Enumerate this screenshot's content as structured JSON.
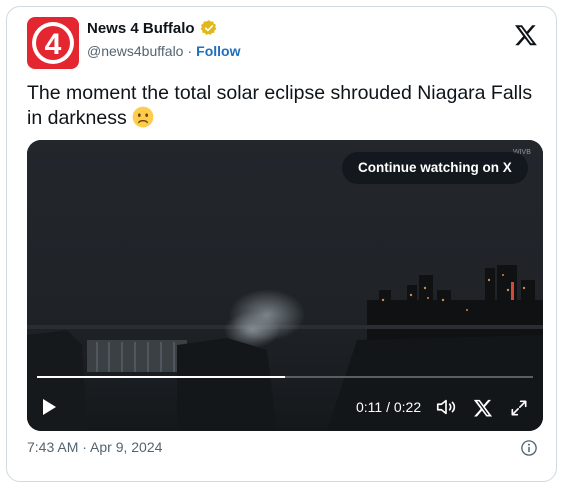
{
  "author": {
    "name": "News 4 Buffalo",
    "handle": "@news4buffalo",
    "separator": "·",
    "follow_label": "Follow",
    "avatar_text": "4",
    "verified_icon": "verified-badge-icon"
  },
  "post": {
    "text": "The moment the total solar eclipse shrouded Niagara Falls in darkness",
    "emoji": "worried-face-emoji"
  },
  "video": {
    "continue_label": "Continue watching on X",
    "current_time": "0:11",
    "duration": "0:22",
    "time_display": "0:11 / 0:22",
    "progress": 0.5,
    "watermark": "WIVB"
  },
  "footer": {
    "timestamp": "7:43 AM · Apr 9, 2024"
  },
  "colors": {
    "avatar_red": "#e3262f",
    "verified_gold": "#e2b719",
    "follow_blue": "#1d6fbf"
  }
}
